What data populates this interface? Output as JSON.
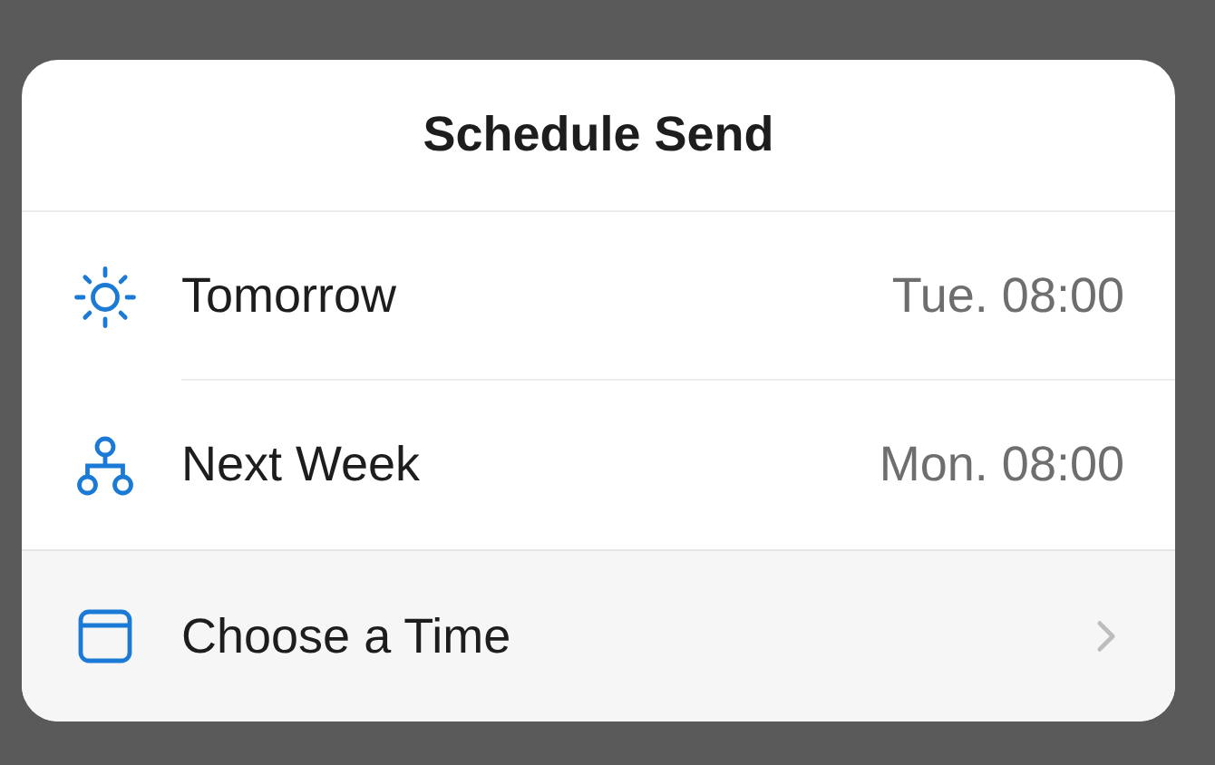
{
  "sheet": {
    "title": "Schedule Send"
  },
  "options": [
    {
      "kind": "preset",
      "label": "Tomorrow",
      "time": "Tue. 08:00"
    },
    {
      "kind": "preset",
      "label": "Next Week",
      "time": "Mon. 08:00"
    },
    {
      "kind": "custom",
      "label": "Choose a Time"
    }
  ]
}
